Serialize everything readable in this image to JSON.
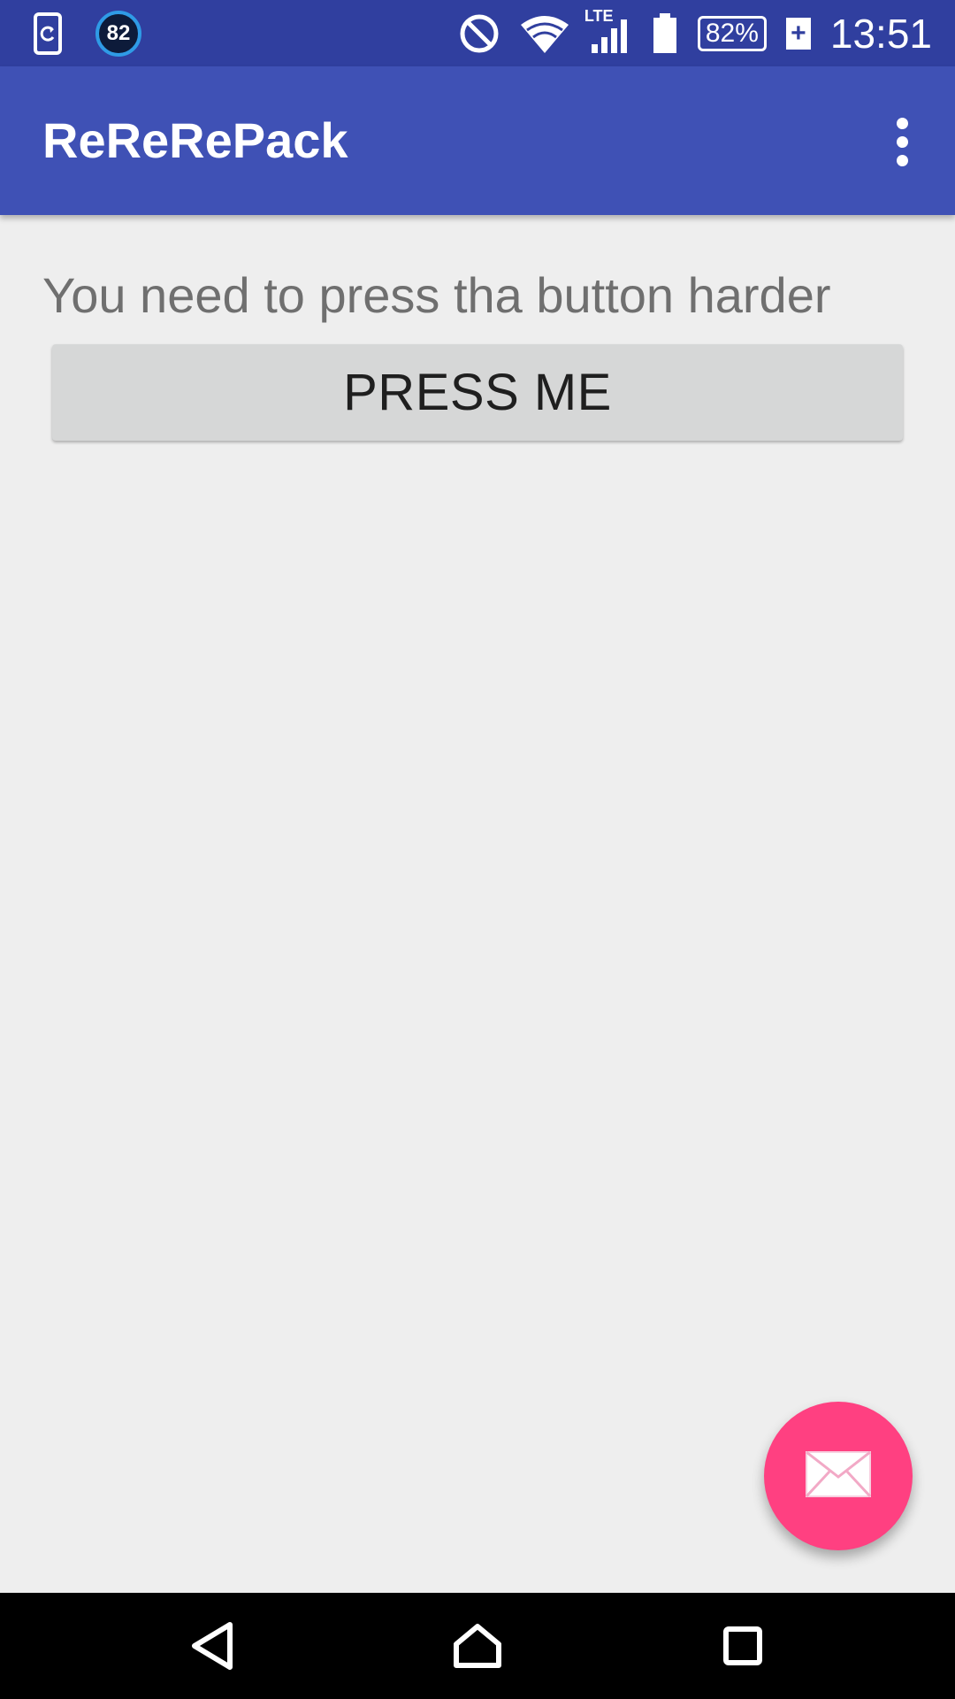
{
  "status_bar": {
    "icons_left": [
      "sync-phone-icon",
      "speed-badge-icon"
    ],
    "badge_value": "82",
    "icons_right": [
      "do-not-disturb-icon",
      "wifi-icon",
      "lte-signal-icon",
      "battery-icon"
    ],
    "network_label": "LTE",
    "battery_percent": "82%",
    "plus": "+",
    "time": "13:51"
  },
  "app_bar": {
    "title": "ReReRePack",
    "overflow_icon": "more-vert-icon"
  },
  "main": {
    "message": "You need to press tha button harder",
    "button_label": "PRESS ME"
  },
  "fab": {
    "icon": "mail-icon"
  },
  "nav_bar": {
    "icons": [
      "back-icon",
      "home-icon",
      "recents-icon"
    ]
  },
  "colors": {
    "status_bar": "#303f9f",
    "app_bar": "#3f51b5",
    "background": "#eeeeee",
    "button": "#d6d7d7",
    "fab": "#ff4081"
  }
}
